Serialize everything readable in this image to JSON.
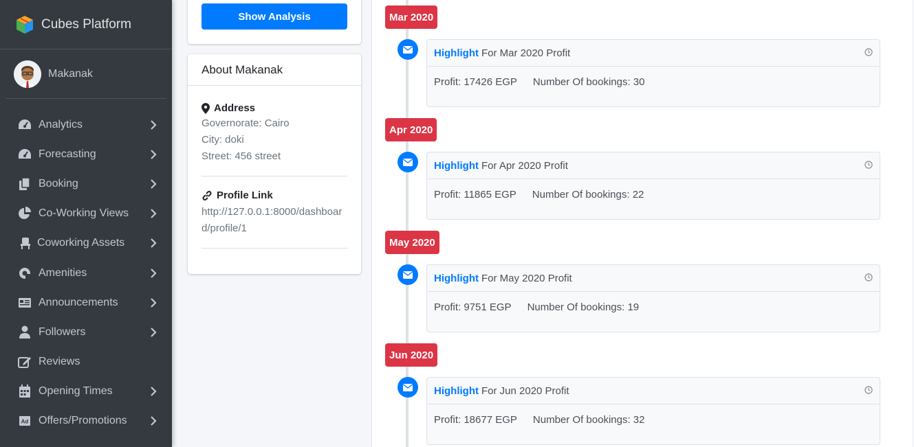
{
  "brand": {
    "name": "Cubes Platform"
  },
  "user": {
    "name": "Makanak"
  },
  "nav": [
    {
      "label": "Analytics",
      "icon": "tachometer-icon",
      "chevron": true
    },
    {
      "label": "Forecasting",
      "icon": "tachometer-icon",
      "chevron": true
    },
    {
      "label": "Booking",
      "icon": "copy-icon",
      "chevron": true
    },
    {
      "label": "Co-Working Views",
      "icon": "pie-chart-icon",
      "chevron": true
    },
    {
      "label": "Coworking Assets",
      "icon": "chair-icon",
      "chevron": true
    },
    {
      "label": "Amenities",
      "icon": "amenities-icon",
      "chevron": true
    },
    {
      "label": "Announcements",
      "icon": "newspaper-icon",
      "chevron": true
    },
    {
      "label": "Followers",
      "icon": "user-icon",
      "chevron": true
    },
    {
      "label": "Reviews",
      "icon": "edit-icon",
      "chevron": false
    },
    {
      "label": "Opening Times",
      "icon": "calendar-icon",
      "chevron": true
    },
    {
      "label": "Offers/Promotions",
      "icon": "ad-icon",
      "chevron": true
    }
  ],
  "actions": {
    "show_analysis": "Show Analysis"
  },
  "about": {
    "title": "About Makanak",
    "address_title": "Address",
    "governorate": "Governorate: Cairo",
    "city": "City: doki",
    "street": "Street: 456 street",
    "profile_link_title": "Profile Link",
    "profile_link": "http://127.0.0.1:8000/dashboard/profile/1"
  },
  "timeline": [
    {
      "label": "Mar 2020",
      "highlight": "Highlight",
      "title": "For Mar 2020 Profit",
      "profit": "Profit: 17426 EGP",
      "bookings": "Number Of bookings: 30"
    },
    {
      "label": "Apr 2020",
      "highlight": "Highlight",
      "title": "For Apr 2020 Profit",
      "profit": "Profit: 11865 EGP",
      "bookings": "Number Of bookings: 22"
    },
    {
      "label": "May 2020",
      "highlight": "Highlight",
      "title": "For May 2020 Profit",
      "profit": "Profit: 9751 EGP",
      "bookings": "Number Of bookings: 19"
    },
    {
      "label": "Jun 2020",
      "highlight": "Highlight",
      "title": "For Jun 2020 Profit",
      "profit": "Profit: 18677 EGP",
      "bookings": "Number Of bookings: 32"
    }
  ],
  "colors": {
    "sidebar": "#343a40",
    "primary": "#007bff",
    "danger": "#dc3545"
  }
}
